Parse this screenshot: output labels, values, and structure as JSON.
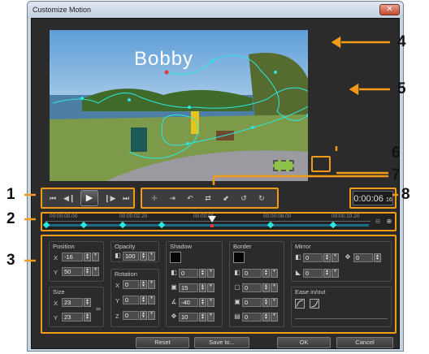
{
  "window": {
    "title": "Customize Motion",
    "close": "✕"
  },
  "preview": {
    "overlay_text": "Bobby"
  },
  "transport": {
    "home": "⏮",
    "prev_frame": "◀❙",
    "play": "▶",
    "next_frame": "❙▶",
    "end": "⏭"
  },
  "keyframe_tools": [
    "✚",
    "⇥",
    "↶",
    "⇄",
    "⬋",
    "↺",
    "↻"
  ],
  "timecode": "0:00:06",
  "timecode_frames": "16",
  "timeline": {
    "ticks": [
      "00:00:00.00",
      "00:00:02.20",
      "00:00:05",
      "00:00:08.00",
      "00:00:10.20"
    ]
  },
  "position": {
    "title": "Position",
    "x_label": "X",
    "x": "-16",
    "y_label": "Y",
    "y": "50"
  },
  "size": {
    "title": "Size",
    "x_label": "X",
    "x": "23",
    "y_label": "Y",
    "y": "23"
  },
  "opacity": {
    "title": "Opacity",
    "value": "100"
  },
  "rotation": {
    "title": "Rotation",
    "x_label": "X",
    "x": "0",
    "y_label": "Y",
    "y": "0",
    "z_label": "Z",
    "z": "0"
  },
  "shadow": {
    "title": "Shadow",
    "opacity": "0",
    "blur": "15",
    "angle": "-40",
    "distance": "10"
  },
  "border": {
    "title": "Border",
    "v1": "0",
    "v2": "0",
    "v3": "0",
    "v4": "0"
  },
  "mirror": {
    "title": "Mirror",
    "opacity": "0",
    "distance": "0",
    "fade": "0"
  },
  "ease": {
    "title": "Ease in/out"
  },
  "buttons": {
    "reset": "Reset",
    "save_to": "Save to...",
    "ok": "OK",
    "cancel": "Cancel"
  },
  "callouts": [
    "1",
    "2",
    "3",
    "4",
    "5",
    "6",
    "7",
    "8"
  ],
  "colors": {
    "accent": "#f29b16",
    "path": "#2ee6e0",
    "background": "#2b2b2b"
  }
}
